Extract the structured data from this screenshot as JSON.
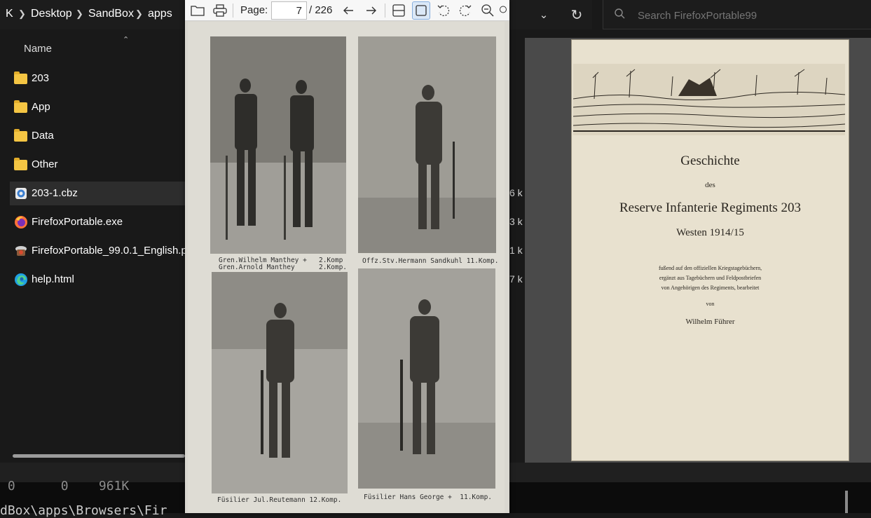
{
  "explorer": {
    "breadcrumb": [
      "K",
      "Desktop",
      "SandBox",
      "apps"
    ],
    "search_placeholder": "Search FirefoxPortable99",
    "column_header": "Name",
    "items": [
      {
        "name": "203",
        "type": "folder",
        "size_fragment": ""
      },
      {
        "name": "App",
        "type": "folder",
        "size_fragment": ""
      },
      {
        "name": "Data",
        "type": "folder",
        "size_fragment": ""
      },
      {
        "name": "Other",
        "type": "folder",
        "size_fragment": ""
      },
      {
        "name": "203-1.cbz",
        "type": "archive",
        "size_fragment": "6 k",
        "selected": true
      },
      {
        "name": "FirefoxPortable.exe",
        "type": "firefox",
        "size_fragment": "3 k"
      },
      {
        "name": "FirefoxPortable_99.0.1_English.paf",
        "type": "installer",
        "size_fragment": "1 k"
      },
      {
        "name": "help.html",
        "type": "edge",
        "size_fragment": "7 k"
      }
    ]
  },
  "viewer": {
    "page_label": "Page:",
    "current_page": "7",
    "total_pages": "/ 226",
    "captions": {
      "top_left_1": "Gren.Wilhelm Manthey +   2.Komp",
      "top_left_2": "Gren.Arnold Manthey      2.Komp.",
      "top_right": "Offz.Stv.Hermann Sandkuhl 11.Komp.",
      "bottom_left": "Füsilier Jul.Reutemann 12.Komp.",
      "bottom_right": "Füsilier Hans George +  11.Komp."
    }
  },
  "preview": {
    "title": "Geschichte",
    "des": "des",
    "regiment": "Reserve Infanterie Regiments 203",
    "period": "Westen 1914/15",
    "line1": "fußend auf den offiziellen Kriegstagebüchern,",
    "line2": "ergänzt aus Tagebüchern und Feldpostbriefen",
    "line3": "von Angehörigen des Regiments, bearbeitet",
    "von": "von",
    "author": "Wilhelm Führer"
  },
  "terminal": {
    "line1": " 0      0    961K",
    "line2": "dBox\\apps\\Browsers\\Fir"
  },
  "colors": {
    "folder": "#f4c543",
    "explorer_bg": "#191919",
    "selection": "#2d2d2d",
    "toolbar_active": "#dbe8f7"
  }
}
